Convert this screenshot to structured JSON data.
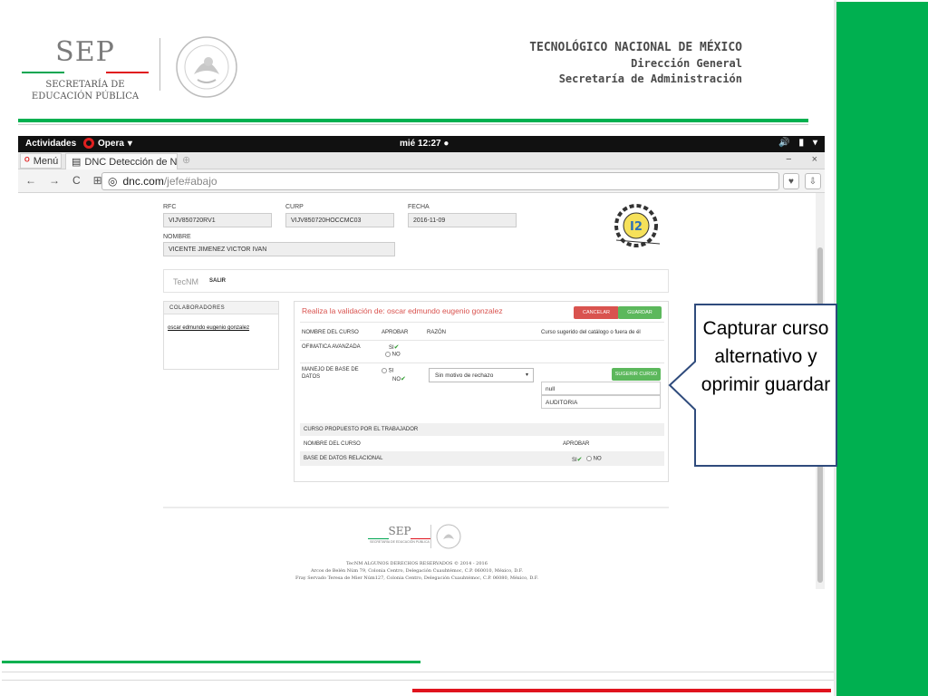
{
  "slide": {
    "header": {
      "sep_logo_word": "SEP",
      "sep_logo_sub1": "SECRETARÍA DE",
      "sep_logo_sub2": "EDUCACIÓN PÚBLICA",
      "institution": "TECNOLÓGICO NACIONAL DE MÉXICO",
      "direction": "Dirección General",
      "secretariat": "Secretaría de Administración"
    },
    "callout_text": "Capturar curso alternativo y oprimir guardar",
    "colors": {
      "green": "#00b050",
      "red": "#e0141e"
    }
  },
  "os_bar": {
    "activities": "Actividades",
    "browser": "Opera",
    "clock": "mié 12:27"
  },
  "browser": {
    "menu_tab": "Menú",
    "active_tab": "DNC Detección de N",
    "url_host": "dnc.com",
    "url_path": "/jefe#abajo"
  },
  "page": {
    "rfc_label": "RFC",
    "rfc_value": "VIJV850720RV1",
    "curp_label": "CURP",
    "curp_value": "VIJV850720HOCCMC03",
    "fecha_label": "FECHA",
    "fecha_value": "2016-11-09",
    "nombre_label": "NOMBRE",
    "nombre_value": "VICENTE JIMENEZ VICTOR IVAN",
    "nav_brand": "TecNM",
    "nav_exit": "SALIR",
    "collaborators": {
      "header": "COLABORADORES",
      "item": "oscar edmundo eugenio gonzalez"
    },
    "validation": {
      "title": "Realiza la validación de: oscar edmundo eugenio gonzalez",
      "cancel_label": "CANCELAR",
      "save_label": "GUARDAR",
      "col_course": "NOMBRE DEL CURSO",
      "col_approve": "APROBAR",
      "col_reason": "RAZÓN",
      "col_suggested": "Curso sugerido del catálogo o fuera de él",
      "rows": [
        {
          "course": "OFIMATICA AVANZADA",
          "yes": "SI",
          "no": "NO"
        },
        {
          "course_line1": "MANEJO DE BASE DE",
          "course_line2": "DATOS",
          "yes": "SI",
          "no": "NO",
          "reason": "Sin motivo de rechazo",
          "suggest_label": "SUGERIR CURSO",
          "suggest_value1": "null",
          "suggest_value2": "AUDITORIA"
        }
      ],
      "proposed_header": "CURSO PROPUESTO POR EL TRABAJADOR",
      "proposed_col_course": "NOMBRE DEL CURSO",
      "proposed_col_approve": "APROBAR",
      "proposed_course": "BASE DE DATOS RELACIONAL",
      "proposed_yes": "SI",
      "proposed_no": "NO"
    },
    "footer": {
      "sep_word": "SEP",
      "sep_sub": "SECRETARÍA DE EDUCACIÓN PÚBLICA",
      "line1": "TecNM ALGUNOS DERECHOS RESERVADOS © 2014 - 2016",
      "line2": "Arcos de Belén Núm 79, Colonia Centro, Delegación Cuauhtémoc, C.P. 060010, México, D.F.",
      "line3": "Fray Servado Teresa de Mier Núm127, Colonia Centro, Delegación Cuauhtémoc, C.P. 06080, México, D.F."
    }
  }
}
